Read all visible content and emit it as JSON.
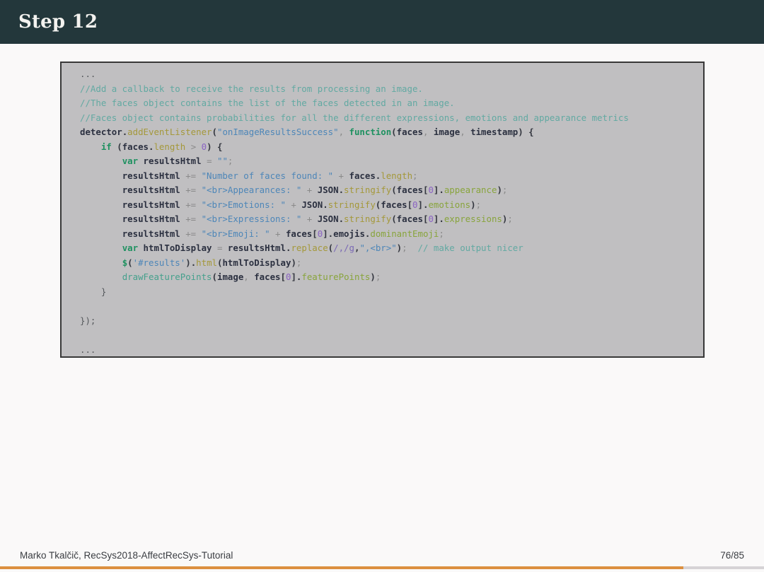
{
  "slide": {
    "title": "Step 12",
    "footer": {
      "author": "Marko Tkalčič, RecSys2018-AffectRecSys-Tutorial",
      "page": "76/85"
    },
    "progress": {
      "current": 76,
      "total": 85
    }
  },
  "colors": {
    "header_bg": "#23373b",
    "header_text": "#f3f2ef",
    "body_bg": "#faf9f9",
    "code_bg": "#c0bfc1",
    "code_border": "#383838",
    "progress_fill": "#dc9040",
    "progress_track": "#d6d3d6",
    "comment": "#62a9a2",
    "keyword": "#1e9160",
    "string": "#4d86b8",
    "number": "#8a63c2"
  },
  "code": {
    "language": "javascript",
    "lines": [
      [
        [
          "pl",
          "..."
        ]
      ],
      [
        [
          "cm",
          "//Add a callback to receive the results from processing an image."
        ]
      ],
      [
        [
          "cm",
          "//The faces object contains the list of the faces detected in an image."
        ]
      ],
      [
        [
          "cm",
          "//Faces object contains probabilities for all the different expressions, emotions and appearance metrics"
        ]
      ],
      [
        [
          "id",
          "detector"
        ],
        [
          "pun",
          "."
        ],
        [
          "mth",
          "addEventListener"
        ],
        [
          "pun",
          "("
        ],
        [
          "str",
          "\"onImageResultsSuccess\""
        ],
        [
          "op",
          ", "
        ],
        [
          "kw",
          "function"
        ],
        [
          "pun",
          "("
        ],
        [
          "id",
          "faces"
        ],
        [
          "op",
          ", "
        ],
        [
          "id",
          "image"
        ],
        [
          "op",
          ", "
        ],
        [
          "id",
          "timestamp"
        ],
        [
          "pun",
          ") {"
        ]
      ],
      [
        [
          "pl",
          "    "
        ],
        [
          "kw",
          "if"
        ],
        [
          "pun",
          " ("
        ],
        [
          "id",
          "faces"
        ],
        [
          "pun",
          "."
        ],
        [
          "mth",
          "length"
        ],
        [
          "op",
          " > "
        ],
        [
          "num",
          "0"
        ],
        [
          "pun",
          ") {"
        ]
      ],
      [
        [
          "pl",
          "        "
        ],
        [
          "kw",
          "var"
        ],
        [
          "id",
          " resultsHtml"
        ],
        [
          "op",
          " = "
        ],
        [
          "str",
          "\"\""
        ],
        [
          "op",
          ";"
        ]
      ],
      [
        [
          "pl",
          "        "
        ],
        [
          "id",
          "resultsHtml"
        ],
        [
          "op",
          " += "
        ],
        [
          "str",
          "\"Number of faces found: \""
        ],
        [
          "op",
          " + "
        ],
        [
          "id",
          "faces"
        ],
        [
          "pun",
          "."
        ],
        [
          "mth",
          "length"
        ],
        [
          "op",
          ";"
        ]
      ],
      [
        [
          "pl",
          "        "
        ],
        [
          "id",
          "resultsHtml"
        ],
        [
          "op",
          " += "
        ],
        [
          "str",
          "\"<br>Appearances: \""
        ],
        [
          "op",
          " + "
        ],
        [
          "id",
          "JSON"
        ],
        [
          "pun",
          "."
        ],
        [
          "mth",
          "stringify"
        ],
        [
          "pun",
          "("
        ],
        [
          "id",
          "faces"
        ],
        [
          "pun",
          "["
        ],
        [
          "num",
          "0"
        ],
        [
          "pun",
          "]."
        ],
        [
          "prop",
          "appearance"
        ],
        [
          "pun",
          ")"
        ],
        [
          "op",
          ";"
        ]
      ],
      [
        [
          "pl",
          "        "
        ],
        [
          "id",
          "resultsHtml"
        ],
        [
          "op",
          " += "
        ],
        [
          "str",
          "\"<br>Emotions: \""
        ],
        [
          "op",
          " + "
        ],
        [
          "id",
          "JSON"
        ],
        [
          "pun",
          "."
        ],
        [
          "mth",
          "stringify"
        ],
        [
          "pun",
          "("
        ],
        [
          "id",
          "faces"
        ],
        [
          "pun",
          "["
        ],
        [
          "num",
          "0"
        ],
        [
          "pun",
          "]."
        ],
        [
          "prop",
          "emotions"
        ],
        [
          "pun",
          ")"
        ],
        [
          "op",
          ";"
        ]
      ],
      [
        [
          "pl",
          "        "
        ],
        [
          "id",
          "resultsHtml"
        ],
        [
          "op",
          " += "
        ],
        [
          "str",
          "\"<br>Expressions: \""
        ],
        [
          "op",
          " + "
        ],
        [
          "id",
          "JSON"
        ],
        [
          "pun",
          "."
        ],
        [
          "mth",
          "stringify"
        ],
        [
          "pun",
          "("
        ],
        [
          "id",
          "faces"
        ],
        [
          "pun",
          "["
        ],
        [
          "num",
          "0"
        ],
        [
          "pun",
          "]."
        ],
        [
          "prop",
          "expressions"
        ],
        [
          "pun",
          ")"
        ],
        [
          "op",
          ";"
        ]
      ],
      [
        [
          "pl",
          "        "
        ],
        [
          "id",
          "resultsHtml"
        ],
        [
          "op",
          " += "
        ],
        [
          "str",
          "\"<br>Emoji: \""
        ],
        [
          "op",
          " + "
        ],
        [
          "id",
          "faces"
        ],
        [
          "pun",
          "["
        ],
        [
          "num",
          "0"
        ],
        [
          "pun",
          "]."
        ],
        [
          "id",
          "emojis"
        ],
        [
          "pun",
          "."
        ],
        [
          "prop",
          "dominantEmoji"
        ],
        [
          "op",
          ";"
        ]
      ],
      [
        [
          "pl",
          "        "
        ],
        [
          "kw",
          "var"
        ],
        [
          "id",
          " htmlToDisplay"
        ],
        [
          "op",
          " = "
        ],
        [
          "id",
          "resultsHtml"
        ],
        [
          "pun",
          "."
        ],
        [
          "mth",
          "replace"
        ],
        [
          "pun",
          "("
        ],
        [
          "rgx",
          "/,/g"
        ],
        [
          "pun",
          ","
        ],
        [
          "str",
          "\",<br>\""
        ],
        [
          "pun",
          ")"
        ],
        [
          "op",
          ";"
        ],
        [
          "cm",
          "  // make output nicer"
        ]
      ],
      [
        [
          "pl",
          "        "
        ],
        [
          "kw",
          "$"
        ],
        [
          "pun",
          "("
        ],
        [
          "str",
          "'#results'"
        ],
        [
          "pun",
          ")."
        ],
        [
          "mth",
          "html"
        ],
        [
          "pun",
          "("
        ],
        [
          "id",
          "htmlToDisplay"
        ],
        [
          "pun",
          ")"
        ],
        [
          "op",
          ";"
        ]
      ],
      [
        [
          "pl",
          "        "
        ],
        [
          "fn",
          "drawFeaturePoints"
        ],
        [
          "pun",
          "("
        ],
        [
          "id",
          "image"
        ],
        [
          "op",
          ", "
        ],
        [
          "id",
          "faces"
        ],
        [
          "pun",
          "["
        ],
        [
          "num",
          "0"
        ],
        [
          "pun",
          "]."
        ],
        [
          "prop",
          "featurePoints"
        ],
        [
          "pun",
          ")"
        ],
        [
          "op",
          ";"
        ]
      ],
      [
        [
          "pl",
          "    }"
        ]
      ],
      [],
      [
        [
          "pl",
          "});"
        ]
      ],
      [],
      [
        [
          "pl",
          "..."
        ]
      ]
    ]
  }
}
